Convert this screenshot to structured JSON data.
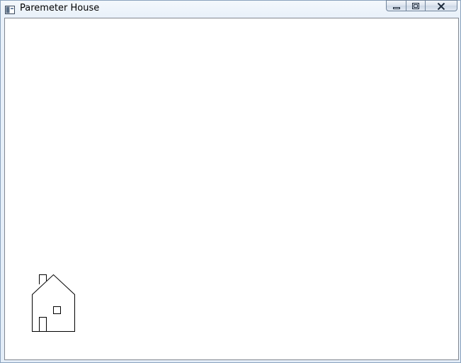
{
  "window": {
    "title": "Paremeter House"
  },
  "icons": {
    "app": "app-window-icon",
    "minimize": "minimize-icon",
    "maximize": "maximize-icon",
    "close": "close-icon",
    "house": "house-drawing"
  },
  "colors": {
    "canvas_background": "#ffffff",
    "drawing_stroke": "#000000",
    "titlebar": "#eaf2fb"
  }
}
